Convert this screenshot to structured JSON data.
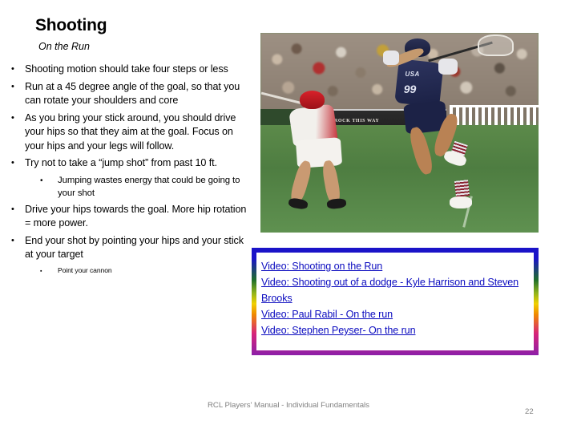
{
  "slide": {
    "title": "Shooting",
    "subtitle": "On the Run"
  },
  "bullets": [
    {
      "level": 1,
      "mark": "•",
      "text": "Shooting motion should take four steps or less"
    },
    {
      "level": 1,
      "mark": "•",
      "text": "Run at a 45 degree angle of the goal, so that you can rotate your shoulders and core"
    },
    {
      "level": 1,
      "mark": "•",
      "text": "As you bring your stick around, you should drive your hips so that they aim at the goal. Focus on your hips and your legs will follow."
    },
    {
      "level": 1,
      "mark": "•",
      "text": "Try not to take a “jump shot” from past 10 ft."
    },
    {
      "level": 2,
      "mark": "•",
      "text": "Jumping wastes energy that could be going to your shot"
    },
    {
      "level": 1,
      "mark": "•",
      "text": "Drive your hips towards the goal.  More hip rotation = more power."
    },
    {
      "level": 1,
      "mark": "•",
      "text": "End your shot by pointing your hips and your stick at your target"
    },
    {
      "level": 3,
      "mark": "▪",
      "text": "Point your cannon"
    }
  ],
  "photo": {
    "alt": "lacrosse-action-photo",
    "banner_text": "ROCK THIS WAY",
    "shooter_team": "USA",
    "shooter_number": "99"
  },
  "video_box": {
    "links": [
      {
        "label": "Video: Shooting on the Run",
        "wrap": false
      },
      {
        "label": "Video: Shooting out of a dodge - Kyle Harrison and Steven Brooks",
        "wrap": true
      },
      {
        "label": "Video: Paul Rabil - On the run",
        "wrap": false
      },
      {
        "label": "Video: Stephen Peyser- On the run",
        "wrap": false
      }
    ],
    "link_color": "#0b0bbf",
    "border_gradient": [
      "#1a13c8",
      "#1f6f2a",
      "#f0d000",
      "#f08a00",
      "#8c1fa8"
    ]
  },
  "footer": {
    "text": "RCL Players' Manual - Individual Fundamentals",
    "page_number": "22",
    "color": "#808080"
  }
}
